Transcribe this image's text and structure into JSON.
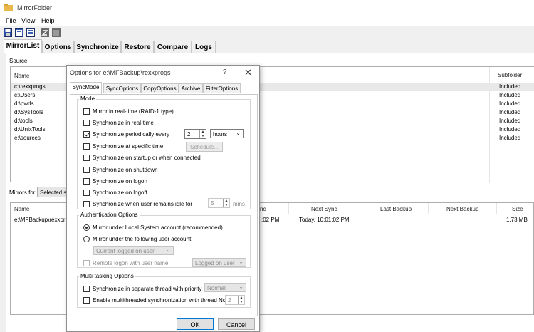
{
  "app": {
    "title": "MirrorFolder"
  },
  "menu": [
    "File",
    "View",
    "Help"
  ],
  "toolbar_icons": [
    "save-icon",
    "open-icon",
    "properties-icon",
    "settings-icon",
    "export-icon"
  ],
  "main_tabs": [
    "MirrorList",
    "Options",
    "Synchronize",
    "Restore",
    "Compare",
    "Logs"
  ],
  "source": {
    "label": "Source:",
    "col_name": "Name",
    "col_subfolder": "Subfolder",
    "rows": [
      {
        "name": "c:\\rexxprogs",
        "subfolder": "Included"
      },
      {
        "name": "c:\\Users",
        "subfolder": "Included"
      },
      {
        "name": "d:\\pwds",
        "subfolder": "Included"
      },
      {
        "name": "d:\\SysTools",
        "subfolder": "Included"
      },
      {
        "name": "d:\\tools",
        "subfolder": "Included"
      },
      {
        "name": "d:\\UnixTools",
        "subfolder": "Included"
      },
      {
        "name": "e:\\sources",
        "subfolder": "Included"
      }
    ]
  },
  "mirrors": {
    "label": "Mirrors for",
    "selected": "Selected so",
    "col_name": "Name",
    "col_last_sync": "nc",
    "col_next_sync": "Next Sync",
    "col_last_backup": "Last Backup",
    "col_next_backup": "Next Backup",
    "col_size": "Size",
    "row": {
      "name": "e:\\MFBackup\\rexxprog",
      "last_sync": ":02 PM",
      "next_sync": "Today, 10:01:02 PM",
      "size": "1.73 MB"
    }
  },
  "dialog": {
    "title": "Options for e:\\MFBackup\\rexxprogs",
    "help": "?",
    "close": "✕",
    "tabs": [
      "SyncMode",
      "SyncOptions",
      "CopyOptions",
      "Archive",
      "FilterOptions"
    ],
    "mode_group": "Mode",
    "mode_options": [
      {
        "label": "Mirror in real-time (RAID-1 type)",
        "checked": false
      },
      {
        "label": "Synchronize in real-time",
        "checked": false
      },
      {
        "label": "Synchronize periodically every",
        "checked": true
      },
      {
        "label": "Synchronize at specific time",
        "checked": false
      },
      {
        "label": "Synchronize on startup or when connected",
        "checked": false
      },
      {
        "label": "Synchronize on shutdown",
        "checked": false
      },
      {
        "label": "Synchronize on logon",
        "checked": false
      },
      {
        "label": "Synchronize on logoff",
        "checked": false
      },
      {
        "label": "Synchronize when user remains idle for",
        "checked": false
      }
    ],
    "period_value": "2",
    "period_unit": "hours",
    "schedule_button": "Schedule...",
    "idle_value": "5",
    "idle_unit": "mins",
    "auth_group": "Authentication Options",
    "auth_local": "Mirror under Local System account (recommended)",
    "auth_user": "Mirror under the following user account",
    "auth_user_select": "Current logged on user",
    "remote_logon": "Remote logon with user name",
    "logged_on_user": "Logged on user",
    "multi_group": "Multi-tasking Options",
    "separate_thread": "Synchronize in separate thread with priority",
    "priority": "Normal",
    "multithread": "Enable multithreaded synchronization with thread No.",
    "thread_count": "2",
    "ok": "OK",
    "cancel": "Cancel"
  }
}
